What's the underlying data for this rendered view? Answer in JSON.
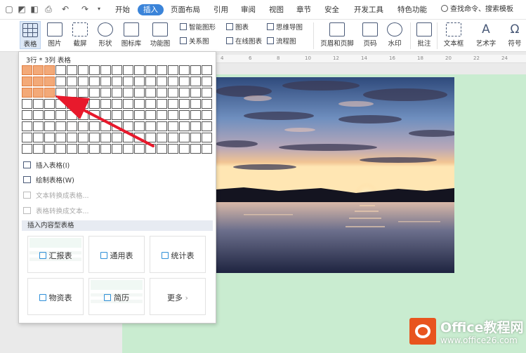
{
  "menu": {
    "tabs": [
      "开始",
      "插入",
      "页面布局",
      "引用",
      "审阅",
      "视图",
      "章节",
      "安全",
      "开发工具",
      "特色功能"
    ],
    "active": "插入",
    "search": "查找命令、搜索模板"
  },
  "ribbon": {
    "table": "表格",
    "picture": "图片",
    "screenshot": "截屏",
    "shape": "形状",
    "icon_lib": "图标库",
    "func_chart": "功能图",
    "smart_shape": "智能图形",
    "chart": "图表",
    "mind_map": "思维导图",
    "relation": "关系图",
    "online_chart": "在线图表",
    "flowchart": "流程图",
    "header_footer": "页眉和页脚",
    "page_num": "页码",
    "watermark": "水印",
    "annotate": "批注",
    "textbox": "文本框",
    "art_text": "艺术字",
    "symbol": "符号"
  },
  "ruler": [
    "4",
    "6",
    "8",
    "10",
    "12",
    "14",
    "16",
    "18",
    "20",
    "22",
    "24"
  ],
  "dropdown": {
    "title": "3行 * 3列 表格",
    "grid_rows": 8,
    "grid_cols": 17,
    "selected_rows": 3,
    "selected_cols": 3,
    "items": [
      {
        "label": "插入表格(I)",
        "enabled": true
      },
      {
        "label": "绘制表格(W)",
        "enabled": true
      },
      {
        "label": "文本转换成表格...",
        "enabled": false
      },
      {
        "label": "表格转换成文本...",
        "enabled": false
      }
    ],
    "section": "插入内容型表格",
    "cards": [
      "汇报表",
      "通用表",
      "统计表",
      "物资表",
      "简历",
      "更多"
    ]
  },
  "watermark": {
    "line1": "Office教程网",
    "line2": "www.office26.com"
  },
  "colors": {
    "accent": "#3b84d9",
    "grid_selected": "#f3a978",
    "page": "#c9ecd0",
    "arrow": "#e8192c",
    "logo": "#e8541e"
  }
}
